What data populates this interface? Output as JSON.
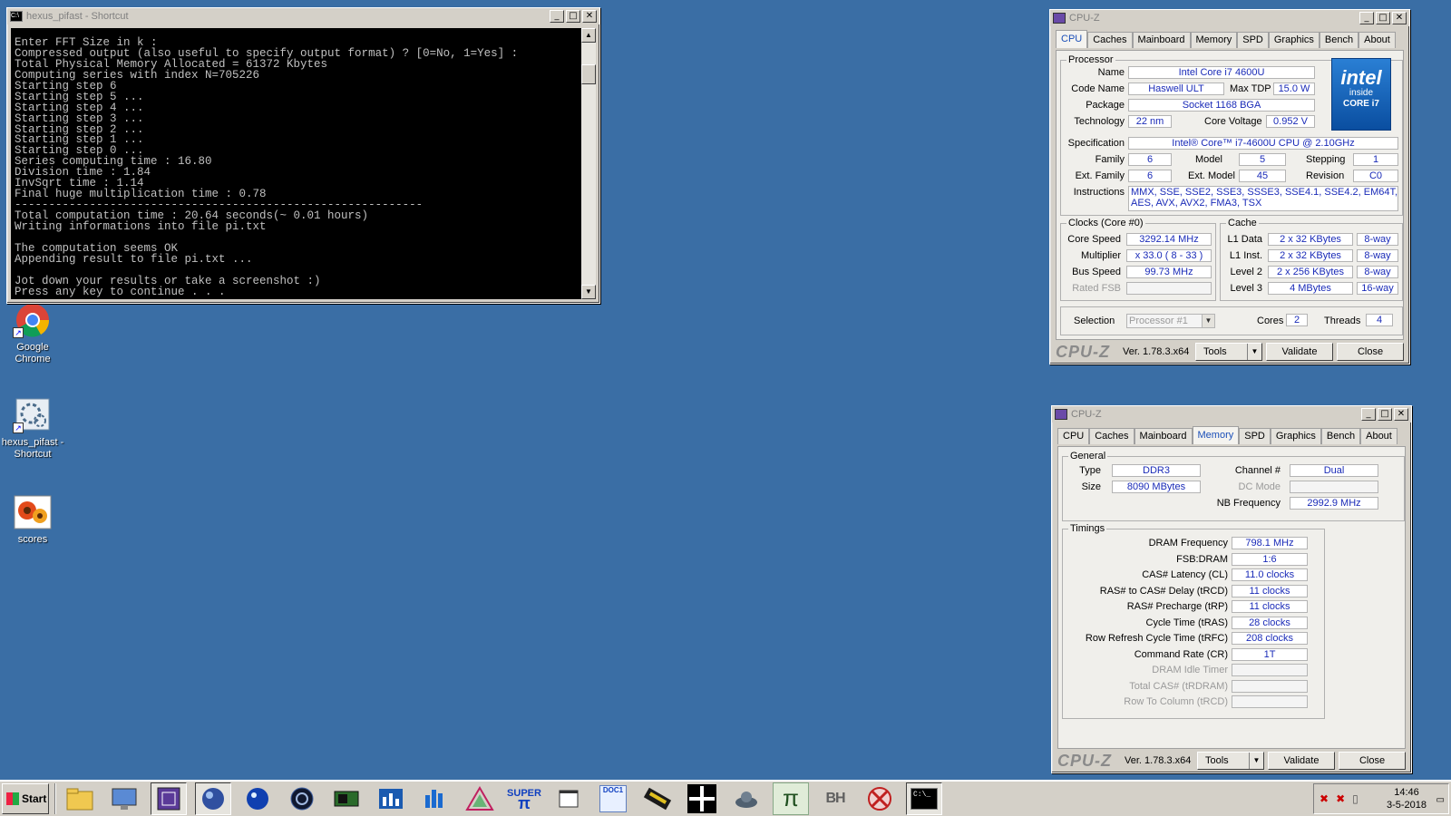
{
  "console": {
    "title": "hexus_pifast - Shortcut",
    "lines": [
      "Enter FFT Size in k :",
      "Compressed output (also useful to specify output format) ? [0=No, 1=Yes] :",
      "Total Physical Memory Allocated = 61372 Kbytes",
      "Computing series with index N=705226",
      "Starting step 6",
      "Starting step 5 ...",
      "Starting step 4 ...",
      "Starting step 3 ...",
      "Starting step 2 ...",
      "Starting step 1 ...",
      "Starting step 0 ...",
      "Series computing time : 16.80",
      "Division time : 1.84",
      "InvSqrt time : 1.14",
      "Final huge multiplication time : 0.78",
      "------------------------------------------------------------",
      "Total computation time : 20.64 seconds(~ 0.01 hours)",
      "Writing informations into file pi.txt",
      "",
      "The computation seems OK",
      "Appending result to file pi.txt ...",
      "",
      "Jot down your results or take a screenshot :)",
      "Press any key to continue . . ."
    ]
  },
  "desktop": {
    "icons": [
      {
        "label": "Google Chrome",
        "icon": "chrome-icon"
      },
      {
        "label": "hexus_pifast - Shortcut",
        "icon": "pifast-icon"
      },
      {
        "label": "scores",
        "icon": "flower-icon"
      }
    ]
  },
  "cpuz1": {
    "title": "CPU-Z",
    "tabs": [
      "CPU",
      "Caches",
      "Mainboard",
      "Memory",
      "SPD",
      "Graphics",
      "Bench",
      "About"
    ],
    "selected_tab": "CPU",
    "processor": {
      "group": "Processor",
      "name_label": "Name",
      "name": "Intel Core i7 4600U",
      "codename_label": "Code Name",
      "codename": "Haswell ULT",
      "maxtdp_label": "Max TDP",
      "maxtdp": "15.0 W",
      "package_label": "Package",
      "package": "Socket 1168 BGA",
      "tech_label": "Technology",
      "tech": "22 nm",
      "voltage_label": "Core Voltage",
      "voltage": "0.952 V",
      "spec_label": "Specification",
      "spec": "Intel® Core™ i7-4600U CPU @ 2.10GHz",
      "family_label": "Family",
      "family": "6",
      "model_label": "Model",
      "model": "5",
      "stepping_label": "Stepping",
      "stepping": "1",
      "extfamily_label": "Ext. Family",
      "extfamily": "6",
      "extmodel_label": "Ext. Model",
      "extmodel": "45",
      "revision_label": "Revision",
      "revision": "C0",
      "instr_label": "Instructions",
      "instr1": "MMX, SSE, SSE2, SSE3, SSSE3, SSE4.1, SSE4.2, EM64T, VT-x,",
      "instr2": "AES, AVX, AVX2, FMA3, TSX",
      "logo_line1": "intel",
      "logo_line2": "inside",
      "logo_line3": "CORE i7"
    },
    "clocks": {
      "group": "Clocks (Core #0)",
      "speed_label": "Core Speed",
      "speed": "3292.14 MHz",
      "mult_label": "Multiplier",
      "mult": "x 33.0 ( 8 - 33 )",
      "bus_label": "Bus Speed",
      "bus": "99.73 MHz",
      "fsb_label": "Rated FSB"
    },
    "cache": {
      "group": "Cache",
      "l1d_label": "L1 Data",
      "l1d": "2 x 32 KBytes",
      "l1d_way": "8-way",
      "l1i_label": "L1 Inst.",
      "l1i": "2 x 32 KBytes",
      "l1i_way": "8-way",
      "l2_label": "Level 2",
      "l2": "2 x 256 KBytes",
      "l2_way": "8-way",
      "l3_label": "Level 3",
      "l3": "4 MBytes",
      "l3_way": "16-way"
    },
    "selection_label": "Selection",
    "selection": "Processor #1",
    "cores_label": "Cores",
    "cores": "2",
    "threads_label": "Threads",
    "threads": "4",
    "logo": "CPU-Z",
    "version": "Ver. 1.78.3.x64",
    "tools": "Tools",
    "validate": "Validate",
    "close": "Close"
  },
  "cpuz2": {
    "title": "CPU-Z",
    "tabs": [
      "CPU",
      "Caches",
      "Mainboard",
      "Memory",
      "SPD",
      "Graphics",
      "Bench",
      "About"
    ],
    "selected_tab": "Memory",
    "general": {
      "group": "General",
      "type_label": "Type",
      "type": "DDR3",
      "size_label": "Size",
      "size": "8090 MBytes",
      "channel_label": "Channel #",
      "channel": "Dual",
      "dcmode_label": "DC Mode",
      "nbfreq_label": "NB Frequency",
      "nbfreq": "2992.9 MHz"
    },
    "timings": {
      "group": "Timings",
      "rows": [
        {
          "label": "DRAM Frequency",
          "value": "798.1 MHz",
          "dim": false
        },
        {
          "label": "FSB:DRAM",
          "value": "1:6",
          "dim": false
        },
        {
          "label": "CAS# Latency (CL)",
          "value": "11.0 clocks",
          "dim": false
        },
        {
          "label": "RAS# to CAS# Delay (tRCD)",
          "value": "11 clocks",
          "dim": false
        },
        {
          "label": "RAS# Precharge (tRP)",
          "value": "11 clocks",
          "dim": false
        },
        {
          "label": "Cycle Time (tRAS)",
          "value": "28 clocks",
          "dim": false
        },
        {
          "label": "Row Refresh Cycle Time (tRFC)",
          "value": "208 clocks",
          "dim": false
        },
        {
          "label": "Command Rate (CR)",
          "value": "1T",
          "dim": false
        },
        {
          "label": "DRAM Idle Timer",
          "value": "",
          "dim": true
        },
        {
          "label": "Total CAS# (tRDRAM)",
          "value": "",
          "dim": true
        },
        {
          "label": "Row To Column (tRCD)",
          "value": "",
          "dim": true
        }
      ]
    },
    "logo": "CPU-Z",
    "version": "Ver. 1.78.3.x64",
    "tools": "Tools",
    "validate": "Validate",
    "close": "Close"
  },
  "taskbar": {
    "start": "Start",
    "icons": [
      "explorer-icon",
      "monitor-icon",
      "cpuz-icon",
      "sphere-icon",
      "orb-icon",
      "cinebench-icon",
      "gpu-icon",
      "chart-icon",
      "bars-icon",
      "aida-icon",
      "superpi-icon",
      "window-icon",
      "doc-icon",
      "memory-icon",
      "cross-icon",
      "tank-icon",
      "pi-icon",
      "bh-icon",
      "x-icon",
      "cmd-icon"
    ],
    "superpi_text": "SUPER",
    "doc_text": "DOC1",
    "bh_text": "BH",
    "time": "14:46",
    "date": "3-5-2018"
  }
}
